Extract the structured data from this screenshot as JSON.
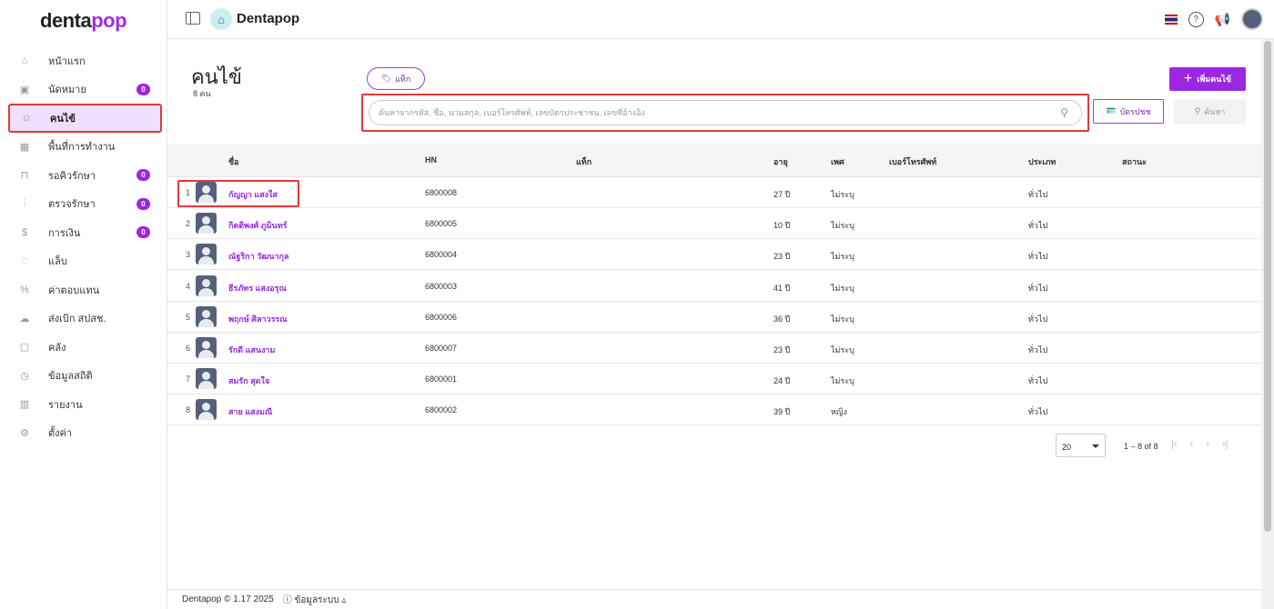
{
  "brand": {
    "logo_dark": "denta",
    "logo_accent": "pop",
    "app_title": "Dentapop"
  },
  "sidebar": {
    "items": [
      {
        "label": "หน้าแรก",
        "icon": "home-icon",
        "badge": null
      },
      {
        "label": "นัดหมาย",
        "icon": "calendar-icon",
        "badge": "0"
      },
      {
        "label": "คนไข้",
        "icon": "user-icon",
        "badge": null,
        "active": true
      },
      {
        "label": "พื้นที่การทำงาน",
        "icon": "workspace-icon",
        "badge": null
      },
      {
        "label": "รอคิวรักษา",
        "icon": "dental-chair-icon",
        "badge": "0"
      },
      {
        "label": "ตรวจรักษา",
        "icon": "dental-tools-icon",
        "badge": "0"
      },
      {
        "label": "การเงิน",
        "icon": "money-hand-icon",
        "badge": "0"
      },
      {
        "label": "แล็บ",
        "icon": "tooth-icon",
        "badge": null
      },
      {
        "label": "ค่าตอบแทน",
        "icon": "percent-icon",
        "badge": null
      },
      {
        "label": "ส่งเบิก สปสช.",
        "icon": "cloud-check-icon",
        "badge": null
      },
      {
        "label": "คลัง",
        "icon": "box-icon",
        "badge": null
      },
      {
        "label": "ข้อมูลสถิติ",
        "icon": "gauge-icon",
        "badge": null
      },
      {
        "label": "รายงาน",
        "icon": "chart-icon",
        "badge": null
      },
      {
        "label": "ตั้งค่า",
        "icon": "gear-icon",
        "badge": null
      }
    ]
  },
  "page": {
    "title": "คนไข้",
    "count": "8 คน",
    "tag_button": "แท็ก",
    "search_placeholder": "ค้นหาจากรหัส, ชื่อ, นามสกุล, เบอร์โทรศัพท์, เลขบัตรประชาชน, เลขที่อ้างอิง",
    "id_card_button": "บัตรปชช",
    "search_button": "ค้นหา",
    "add_button": "เพิ่มคนไข้"
  },
  "table": {
    "headers": [
      "ชื่อ",
      "HN",
      "แท็ก",
      "อายุ",
      "เพศ",
      "เบอร์โทรศัพท์",
      "ประเภท",
      "สถานะ"
    ],
    "rows": [
      {
        "idx": "1",
        "name": "กัญญา แสงใส",
        "hn": "6800008",
        "tag": "",
        "age": "27 ปี",
        "sex": "ไม่ระบุ",
        "phone": "",
        "type": "ทั่วไป",
        "status": ""
      },
      {
        "idx": "2",
        "name": "กิตติพงศ์ ภูมินทร์",
        "hn": "6800005",
        "tag": "",
        "age": "10 ปี",
        "sex": "ไม่ระบุ",
        "phone": "",
        "type": "ทั่วไป",
        "status": ""
      },
      {
        "idx": "3",
        "name": "ณัฐริกา วัฒนากุล",
        "hn": "6800004",
        "tag": "",
        "age": "23 ปี",
        "sex": "ไม่ระบุ",
        "phone": "",
        "type": "ทั่วไป",
        "status": ""
      },
      {
        "idx": "4",
        "name": "ธีรภัทร แสงอรุณ",
        "hn": "6800003",
        "tag": "",
        "age": "41 ปี",
        "sex": "ไม่ระบุ",
        "phone": "",
        "type": "ทั่วไป",
        "status": ""
      },
      {
        "idx": "5",
        "name": "พฤกษ์ ศิลาวรรณ",
        "hn": "6800006",
        "tag": "",
        "age": "36 ปี",
        "sex": "ไม่ระบุ",
        "phone": "",
        "type": "ทั่วไป",
        "status": ""
      },
      {
        "idx": "6",
        "name": "รักดี แสนงาม",
        "hn": "6800007",
        "tag": "",
        "age": "23 ปี",
        "sex": "ไม่ระบุ",
        "phone": "",
        "type": "ทั่วไป",
        "status": ""
      },
      {
        "idx": "7",
        "name": "สมรัก สุดใจ",
        "hn": "6800001",
        "tag": "",
        "age": "24 ปี",
        "sex": "ไม่ระบุ",
        "phone": "",
        "type": "ทั่วไป",
        "status": ""
      },
      {
        "idx": "8",
        "name": "สาย แสงมณี",
        "hn": "6800002",
        "tag": "",
        "age": "39 ปี",
        "sex": "หญิง",
        "phone": "",
        "type": "ทั่วไป",
        "status": ""
      }
    ]
  },
  "pagination": {
    "page_size": "20",
    "range": "1 – 8 of 8"
  },
  "footer": {
    "copyright": "Dentapop © 1.17 2025",
    "system_info": "ข้อมูลระบบ"
  },
  "colors": {
    "accent": "#9b28e0",
    "highlight": "#e03a3a"
  }
}
